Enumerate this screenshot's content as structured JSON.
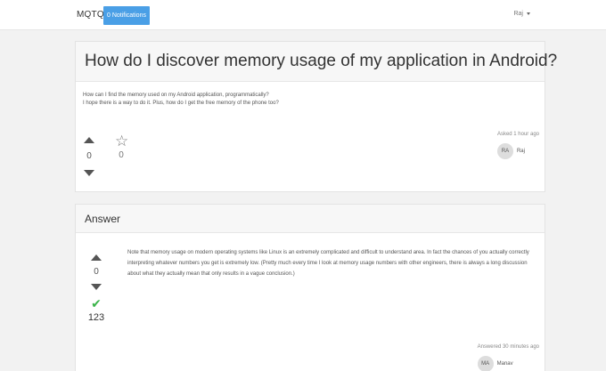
{
  "navbar": {
    "brand": "MQTQ",
    "notifications": "0 Notifications",
    "user": "Raj"
  },
  "question": {
    "title": "How do I discover memory usage of my application in Android?",
    "body_line1": "How can I find the memory used on my Android application, programmatically?",
    "body_line2": "I hope there is a way to do it. Plus, how do I get the free memory of the phone too?",
    "votes": "0",
    "stars": "0",
    "asked": "Asked 1 hour ago",
    "author_initials": "RA",
    "author_name": "Raj"
  },
  "answer": {
    "header": "Answer",
    "body": "Note that memory usage on modern operating systems like Linux is an extremely complicated and difficult to understand area. In fact the chances of you actually correctly interpreting whatever numbers you get is extremely low. (Pretty much every time I look at memory usage numbers with other engineers, there is always a long discussion about what they actually mean that only results in a vague conclusion.)",
    "votes": "0",
    "accepted_count": "123",
    "answered": "Answered 30 minutes ago",
    "author_initials": "MA",
    "author_name": "Manav"
  },
  "colors": {
    "accent": "#4a9fe6",
    "accepted": "#3bb44a",
    "background": "#f2f2f2"
  },
  "icons": {
    "upvote": "caret-up-icon",
    "downvote": "caret-down-icon",
    "favorite": "star-outline-icon",
    "accepted": "check-icon",
    "user_menu": "chevron-down-icon"
  }
}
